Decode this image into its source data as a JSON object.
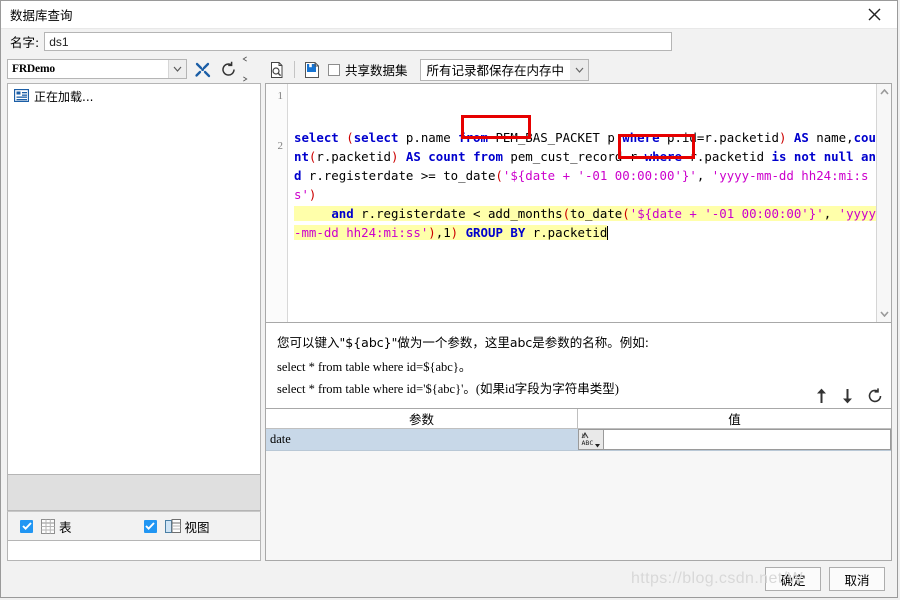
{
  "window": {
    "title": "数据库查询",
    "close_icon": "close-icon"
  },
  "name_field": {
    "label": "名字:",
    "value": "ds1"
  },
  "left_panel": {
    "connection_combo": {
      "value": "FRDemo",
      "arrow_icon": "chevron-down-icon"
    },
    "toolbar": [
      {
        "name": "wrench-icon",
        "tooltip": ""
      },
      {
        "name": "refresh-icon",
        "tooltip": ""
      }
    ],
    "tree": {
      "items": [
        {
          "icon": "database-schema-icon",
          "label": "正在加载..."
        }
      ]
    },
    "checkboxes": [
      {
        "icon": "table-icon",
        "label": "表",
        "checked": true
      },
      {
        "icon": "view-icon",
        "label": "视图",
        "checked": true
      }
    ]
  },
  "right_panel": {
    "toolbar": {
      "preview_icon": "page-search-icon",
      "save_icon": "save-blue-icon",
      "shared_dataset": {
        "label": "共享数据集",
        "checked": false
      },
      "memory_combo": {
        "value": "所有记录都保存在内存中",
        "arrow_icon": "chevron-down-icon"
      }
    },
    "editor": {
      "line_numbers": [
        "1",
        "2"
      ],
      "sql_lines": [
        {
          "num": "1",
          "tokens": [
            {
              "t": "select ",
              "c": "k"
            },
            {
              "t": "(",
              "c": "p"
            },
            {
              "t": "select ",
              "c": "k"
            },
            {
              "t": "p.name ",
              "c": "n"
            },
            {
              "t": "from ",
              "c": "k"
            },
            {
              "t": "PEM_BAS_PACKET p ",
              "c": "n"
            },
            {
              "t": "where ",
              "c": "k"
            },
            {
              "t": "p.id=r.packetid",
              "c": "n"
            },
            {
              "t": ")",
              "c": "p"
            },
            {
              "t": " AS ",
              "c": "k"
            },
            {
              "t": "name,",
              "c": "n"
            },
            {
              "t": "count",
              "c": "k"
            },
            {
              "t": "(",
              "c": "p"
            },
            {
              "t": "r.packetid",
              "c": "n"
            },
            {
              "t": ")",
              "c": "p"
            },
            {
              "t": " AS count ",
              "c": "k"
            },
            {
              "t": "from ",
              "c": "k"
            },
            {
              "t": "pem_cust_record r ",
              "c": "n"
            },
            {
              "t": "where ",
              "c": "k"
            },
            {
              "t": "r.packetid ",
              "c": "n"
            },
            {
              "t": "is not null ",
              "c": "k"
            },
            {
              "t": "and ",
              "c": "k"
            },
            {
              "t": "r.registerdate >= to_date",
              "c": "n"
            },
            {
              "t": "(",
              "c": "p"
            },
            {
              "t": "'${date + '-01 00:00:00'}'",
              "c": "s"
            },
            {
              "t": ", ",
              "c": "n"
            },
            {
              "t": "'yyyy-mm-dd hh24:mi:ss'",
              "c": "s"
            },
            {
              "t": ")",
              "c": "p"
            }
          ]
        },
        {
          "num": "2",
          "tokens": [
            {
              "t": "     and ",
              "c": "k"
            },
            {
              "t": "r.registerdate < add_months",
              "c": "n"
            },
            {
              "t": "(",
              "c": "p"
            },
            {
              "t": "to_date",
              "c": "n"
            },
            {
              "t": "(",
              "c": "p"
            },
            {
              "t": "'${date + '-01 00:00:00'}'",
              "c": "s"
            },
            {
              "t": ", ",
              "c": "n"
            },
            {
              "t": "'yyyy-mm-dd hh24:mi:ss'",
              "c": "s"
            },
            {
              "t": ")",
              "c": "p"
            },
            {
              "t": ",1",
              "c": "n"
            },
            {
              "t": ")",
              "c": "p"
            },
            {
              "t": " GROUP BY ",
              "c": "k"
            },
            {
              "t": "r.packetid",
              "c": "n"
            }
          ]
        }
      ],
      "annotations": [
        {
          "name": "redbox-date-param-1"
        },
        {
          "name": "redbox-date-param-2"
        }
      ],
      "scrollbar": {
        "up_icon": "chevron-up-icon",
        "down_icon": "chevron-down-icon"
      }
    },
    "help": {
      "line1": "您可以键入\"${abc}\"做为一个参数，这里abc是参数的名称。例如:",
      "line2": "select * from table where id=${abc}。",
      "line3": "select * from table where id='${abc}'。(如果id字段为字符串类型)",
      "actions": [
        {
          "name": "move-up-icon",
          "glyph": "↑"
        },
        {
          "name": "move-down-icon",
          "glyph": "↓"
        },
        {
          "name": "refresh-params-icon",
          "glyph": "⟳"
        }
      ]
    },
    "param_table": {
      "columns": [
        "参数",
        "值"
      ],
      "rows": [
        {
          "param": "date",
          "type_icon": "abc-string-type-icon",
          "value": ""
        }
      ]
    }
  },
  "footer": {
    "watermark": "https://blog.csdn.net/W",
    "ok_label": "确定",
    "cancel_label": "取消"
  },
  "colors": {
    "accent_blue": "#2196f3",
    "keyword": "#0000cd",
    "string": "#cc00cc",
    "paren": "#cc0000",
    "highlight": "#ffffaa",
    "annotation_red": "#e60000",
    "row_select": "#c8d8e8"
  }
}
